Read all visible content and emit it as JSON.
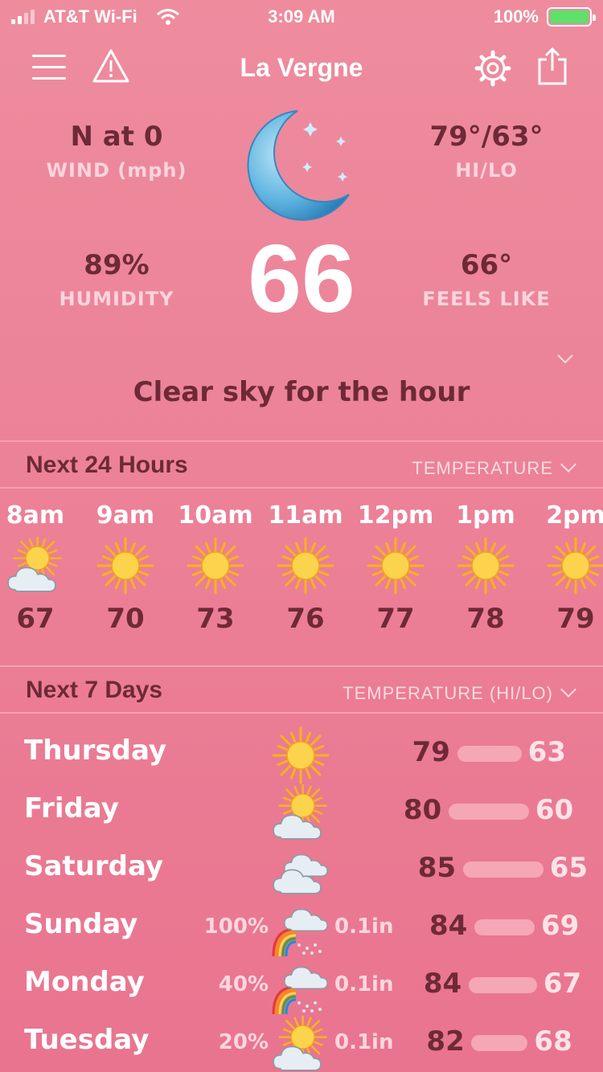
{
  "status_bar": {
    "carrier": "AT&T Wi-Fi",
    "time": "3:09 AM",
    "battery": "100%"
  },
  "nav": {
    "title": "La Vergne",
    "menu_icon": "hamburger-menu-icon",
    "alert_icon": "warning-triangle-icon",
    "settings_icon": "gear-icon",
    "share_icon": "share-icon"
  },
  "current": {
    "wind_value": "N at 0",
    "wind_label": "WIND (mph)",
    "hilo_value": "79°/63°",
    "hilo_label": "HI/LO",
    "humidity_value": "89%",
    "humidity_label": "HUMIDITY",
    "temperature": "66",
    "feels_value": "66°",
    "feels_label": "FEELS LIKE",
    "condition_icon": "crescent-moon-stars-icon",
    "summary": "Clear sky for the hour"
  },
  "hourly": {
    "title": "Next 24 Hours",
    "option": "TEMPERATURE",
    "items": [
      {
        "time": "8am",
        "temp": "67",
        "icon": "partly-cloudy-icon"
      },
      {
        "time": "9am",
        "temp": "70",
        "icon": "sun-icon"
      },
      {
        "time": "10am",
        "temp": "73",
        "icon": "sun-icon"
      },
      {
        "time": "11am",
        "temp": "76",
        "icon": "sun-icon"
      },
      {
        "time": "12pm",
        "temp": "77",
        "icon": "sun-icon"
      },
      {
        "time": "1pm",
        "temp": "78",
        "icon": "sun-icon"
      },
      {
        "time": "2pm",
        "temp": "79",
        "icon": "sun-icon"
      }
    ]
  },
  "daily": {
    "title": "Next 7 Days",
    "option": "TEMPERATURE (HI/LO)",
    "items": [
      {
        "day": "Thursday",
        "precip": "",
        "rain": "",
        "hi": "79",
        "lo": "63",
        "icon": "sun-icon"
      },
      {
        "day": "Friday",
        "precip": "",
        "rain": "",
        "hi": "80",
        "lo": "60",
        "icon": "partly-cloudy-icon"
      },
      {
        "day": "Saturday",
        "precip": "",
        "rain": "",
        "hi": "85",
        "lo": "65",
        "icon": "cloudy-icon"
      },
      {
        "day": "Sunday",
        "precip": "100%",
        "rain": "0.1in",
        "hi": "84",
        "lo": "69",
        "icon": "rain-rainbow-icon"
      },
      {
        "day": "Monday",
        "precip": "40%",
        "rain": "0.1in",
        "hi": "84",
        "lo": "67",
        "icon": "rain-rainbow-icon"
      },
      {
        "day": "Tuesday",
        "precip": "20%",
        "rain": "0.1in",
        "hi": "82",
        "lo": "68",
        "icon": "partly-cloudy-icon"
      }
    ]
  },
  "colors": {
    "background": "#ee8c9e",
    "text_dark": "#6d2a36",
    "text_light": "#ffffff",
    "accent_sun": "#f7b924"
  }
}
